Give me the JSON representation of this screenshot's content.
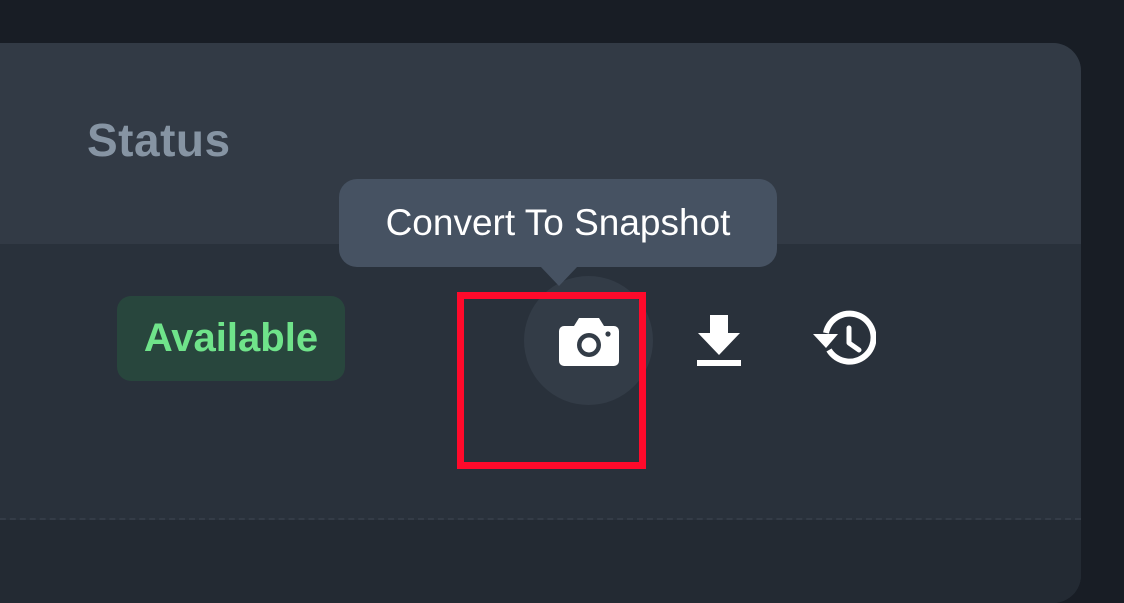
{
  "table": {
    "header": {
      "status_column": "Status"
    },
    "row": {
      "status_badge": "Available",
      "actions": [
        {
          "name": "convert-to-snapshot",
          "icon": "camera-icon"
        },
        {
          "name": "download",
          "icon": "download-icon"
        },
        {
          "name": "history",
          "icon": "history-icon"
        }
      ]
    }
  },
  "tooltip": {
    "text": "Convert To Snapshot"
  },
  "colors": {
    "status_available_text": "#6fe38a",
    "status_available_bg": "#28463d",
    "highlight": "#ff0a2b"
  }
}
